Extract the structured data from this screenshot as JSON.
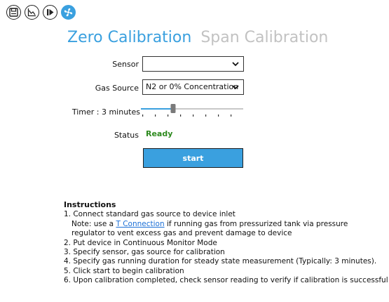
{
  "toolbar": {
    "buttons": [
      {
        "icon": "save-icon",
        "active": false
      },
      {
        "icon": "chart-icon",
        "active": false
      },
      {
        "icon": "play-step-icon",
        "active": false
      },
      {
        "icon": "fan-icon",
        "active": true
      }
    ]
  },
  "tabs": [
    {
      "label": "Zero Calibration",
      "active": true
    },
    {
      "label": "Span Calibration",
      "active": false
    }
  ],
  "form": {
    "sensor_label": "Sensor",
    "sensor_value": "",
    "gas_source_label": "Gas Source",
    "gas_source_value": "N2 or 0% Concentration",
    "timer_label": "Timer : 3 minutes",
    "timer_value_minutes": 3,
    "timer_ticks": 8,
    "status_label": "Status",
    "status_value": "Ready",
    "start_label": "start"
  },
  "instructions": {
    "title": "Instructions",
    "step1": "1. Connect standard gas source to device inlet",
    "note_pre": "Note: use a ",
    "note_link": "T Connection",
    "note_post": " if running gas from pressurized tank via pressure",
    "note_line2": "regulator to vent excess gas and prevent damage to device",
    "step2": "2. Put device in Continuous Monitor Mode",
    "step3": "3. Specify sensor, gas source for calibration",
    "step4": "4. Specify gas running duration for steady state measurement (Typically: 3 minutes).",
    "step5": "5. Click start to begin calibration",
    "step6": "6. Upon calibration completed, check sensor reading to verify if calibration is successful"
  },
  "colors": {
    "accent": "#3aa0df",
    "status_ok": "#2d8a1e",
    "inactive_tab": "#c2c2c2",
    "link": "#1b6fd6"
  }
}
